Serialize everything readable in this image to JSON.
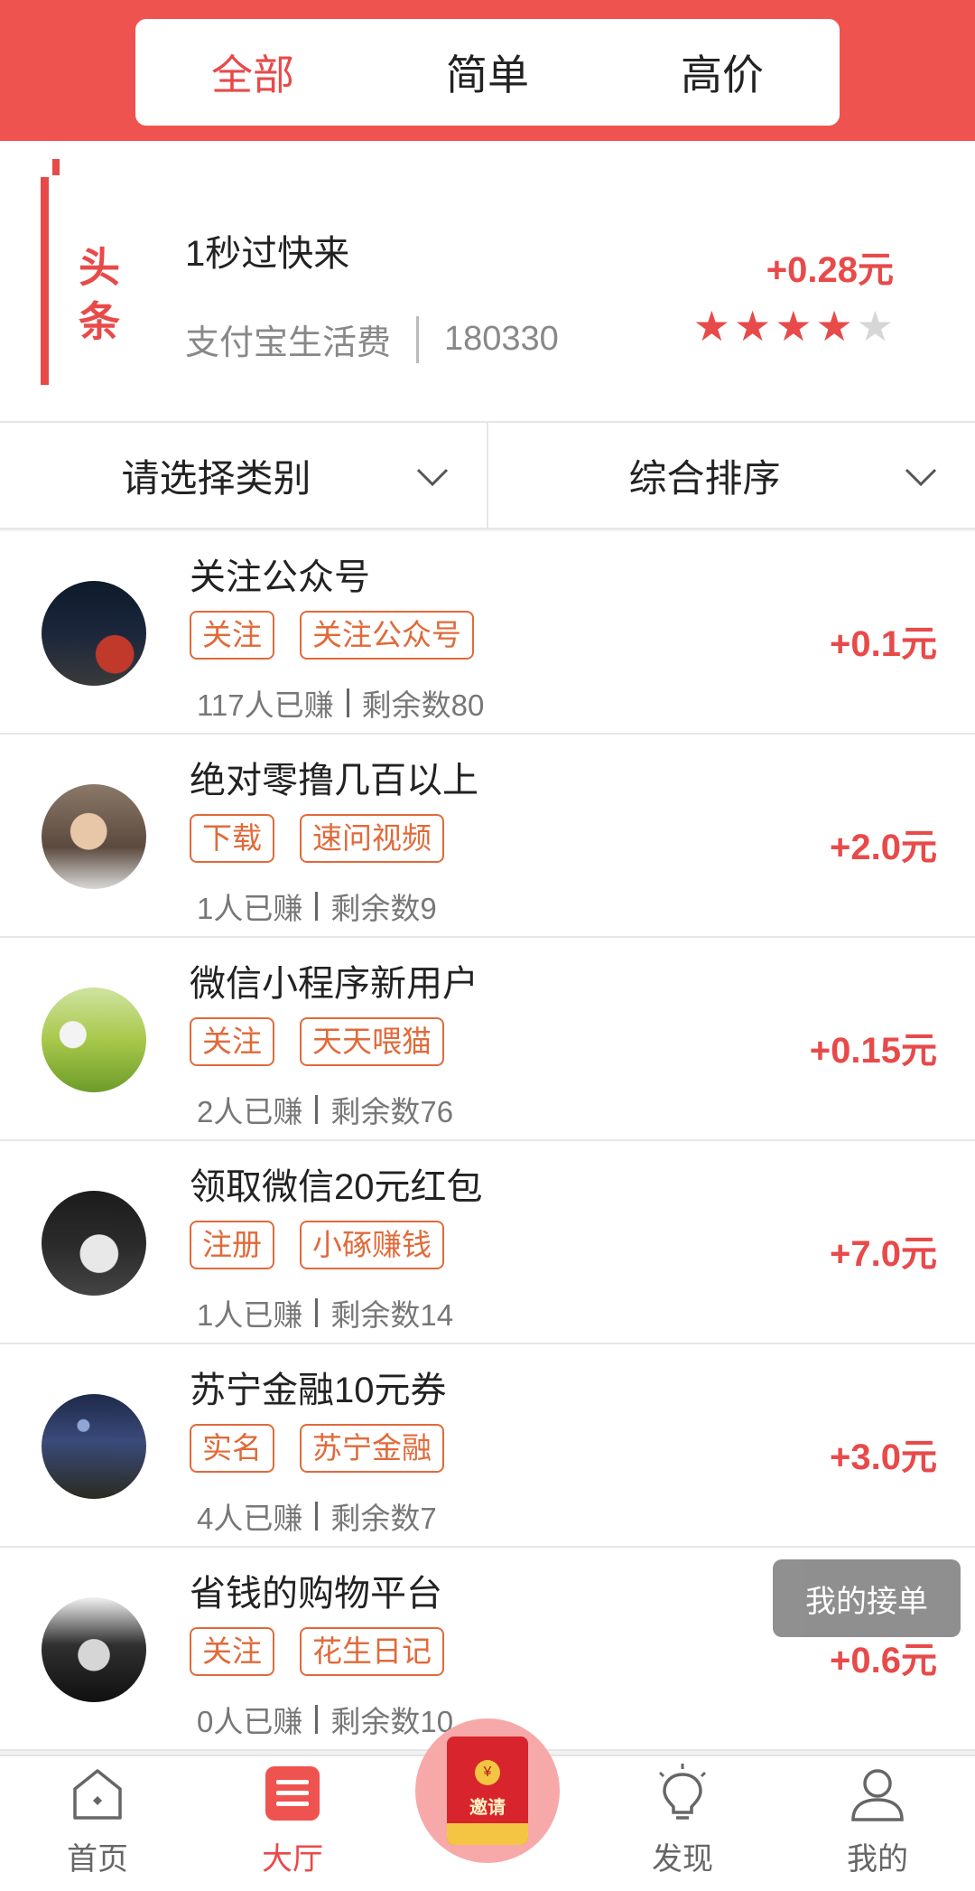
{
  "tabs": [
    {
      "label": "全部",
      "active": true
    },
    {
      "label": "简单",
      "active": false
    },
    {
      "label": "高价",
      "active": false
    }
  ],
  "headline": {
    "badge": "头条",
    "title": "1秒过快来",
    "category": "支付宝生活费",
    "code": "180330",
    "price": "+0.28元",
    "rating": 4,
    "rating_max": 5
  },
  "filters": {
    "category_label": "请选择类别",
    "sort_label": "综合排序"
  },
  "tasks": [
    {
      "title": "关注公众号",
      "tags": [
        "关注",
        "关注公众号"
      ],
      "earned": "117人已赚",
      "remaining": "剩余数80",
      "price": "+0.1元",
      "avatar": "city-night-avatar"
    },
    {
      "title": "绝对零撸几百以上",
      "tags": [
        "下载",
        "速问视频"
      ],
      "earned": "1人已赚",
      "remaining": "剩余数9",
      "price": "+2.0元",
      "avatar": "man-portrait-avatar"
    },
    {
      "title": "微信小程序新用户",
      "tags": [
        "关注",
        "天天喂猫"
      ],
      "earned": "2人已赚",
      "remaining": "剩余数76",
      "price": "+0.15元",
      "avatar": "couple-field-avatar"
    },
    {
      "title": "领取微信20元红包",
      "tags": [
        "注册",
        "小硺赚钱"
      ],
      "earned": "1人已赚",
      "remaining": "剩余数14",
      "price": "+7.0元",
      "avatar": "anime-boy-avatar"
    },
    {
      "title": "苏宁金融10元券",
      "tags": [
        "实名",
        "苏宁金融"
      ],
      "earned": "4人已赚",
      "remaining": "剩余数7",
      "price": "+3.0元",
      "avatar": "starry-sky-avatar"
    },
    {
      "title": "省钱的购物平台",
      "tags": [
        "关注",
        "花生日记"
      ],
      "earned": "0人已赚",
      "remaining": "剩余数10",
      "price": "+0.6元",
      "avatar": "bw-portrait-avatar"
    }
  ],
  "float_button": "我的接单",
  "nav": {
    "items": [
      {
        "label": "首页",
        "icon": "home-icon",
        "active": false
      },
      {
        "label": "大厅",
        "icon": "hall-icon",
        "active": true
      },
      {
        "label": "",
        "icon": "red-envelope-icon",
        "active": false
      },
      {
        "label": "发现",
        "icon": "lightbulb-icon",
        "active": false
      },
      {
        "label": "我的",
        "icon": "user-icon",
        "active": false
      }
    ],
    "invite_text": "邀请",
    "invite_coin": "¥"
  },
  "colors": {
    "brand_red": "#ef5350",
    "price_red": "#e84a4a",
    "tag_orange": "#e06a3a"
  }
}
